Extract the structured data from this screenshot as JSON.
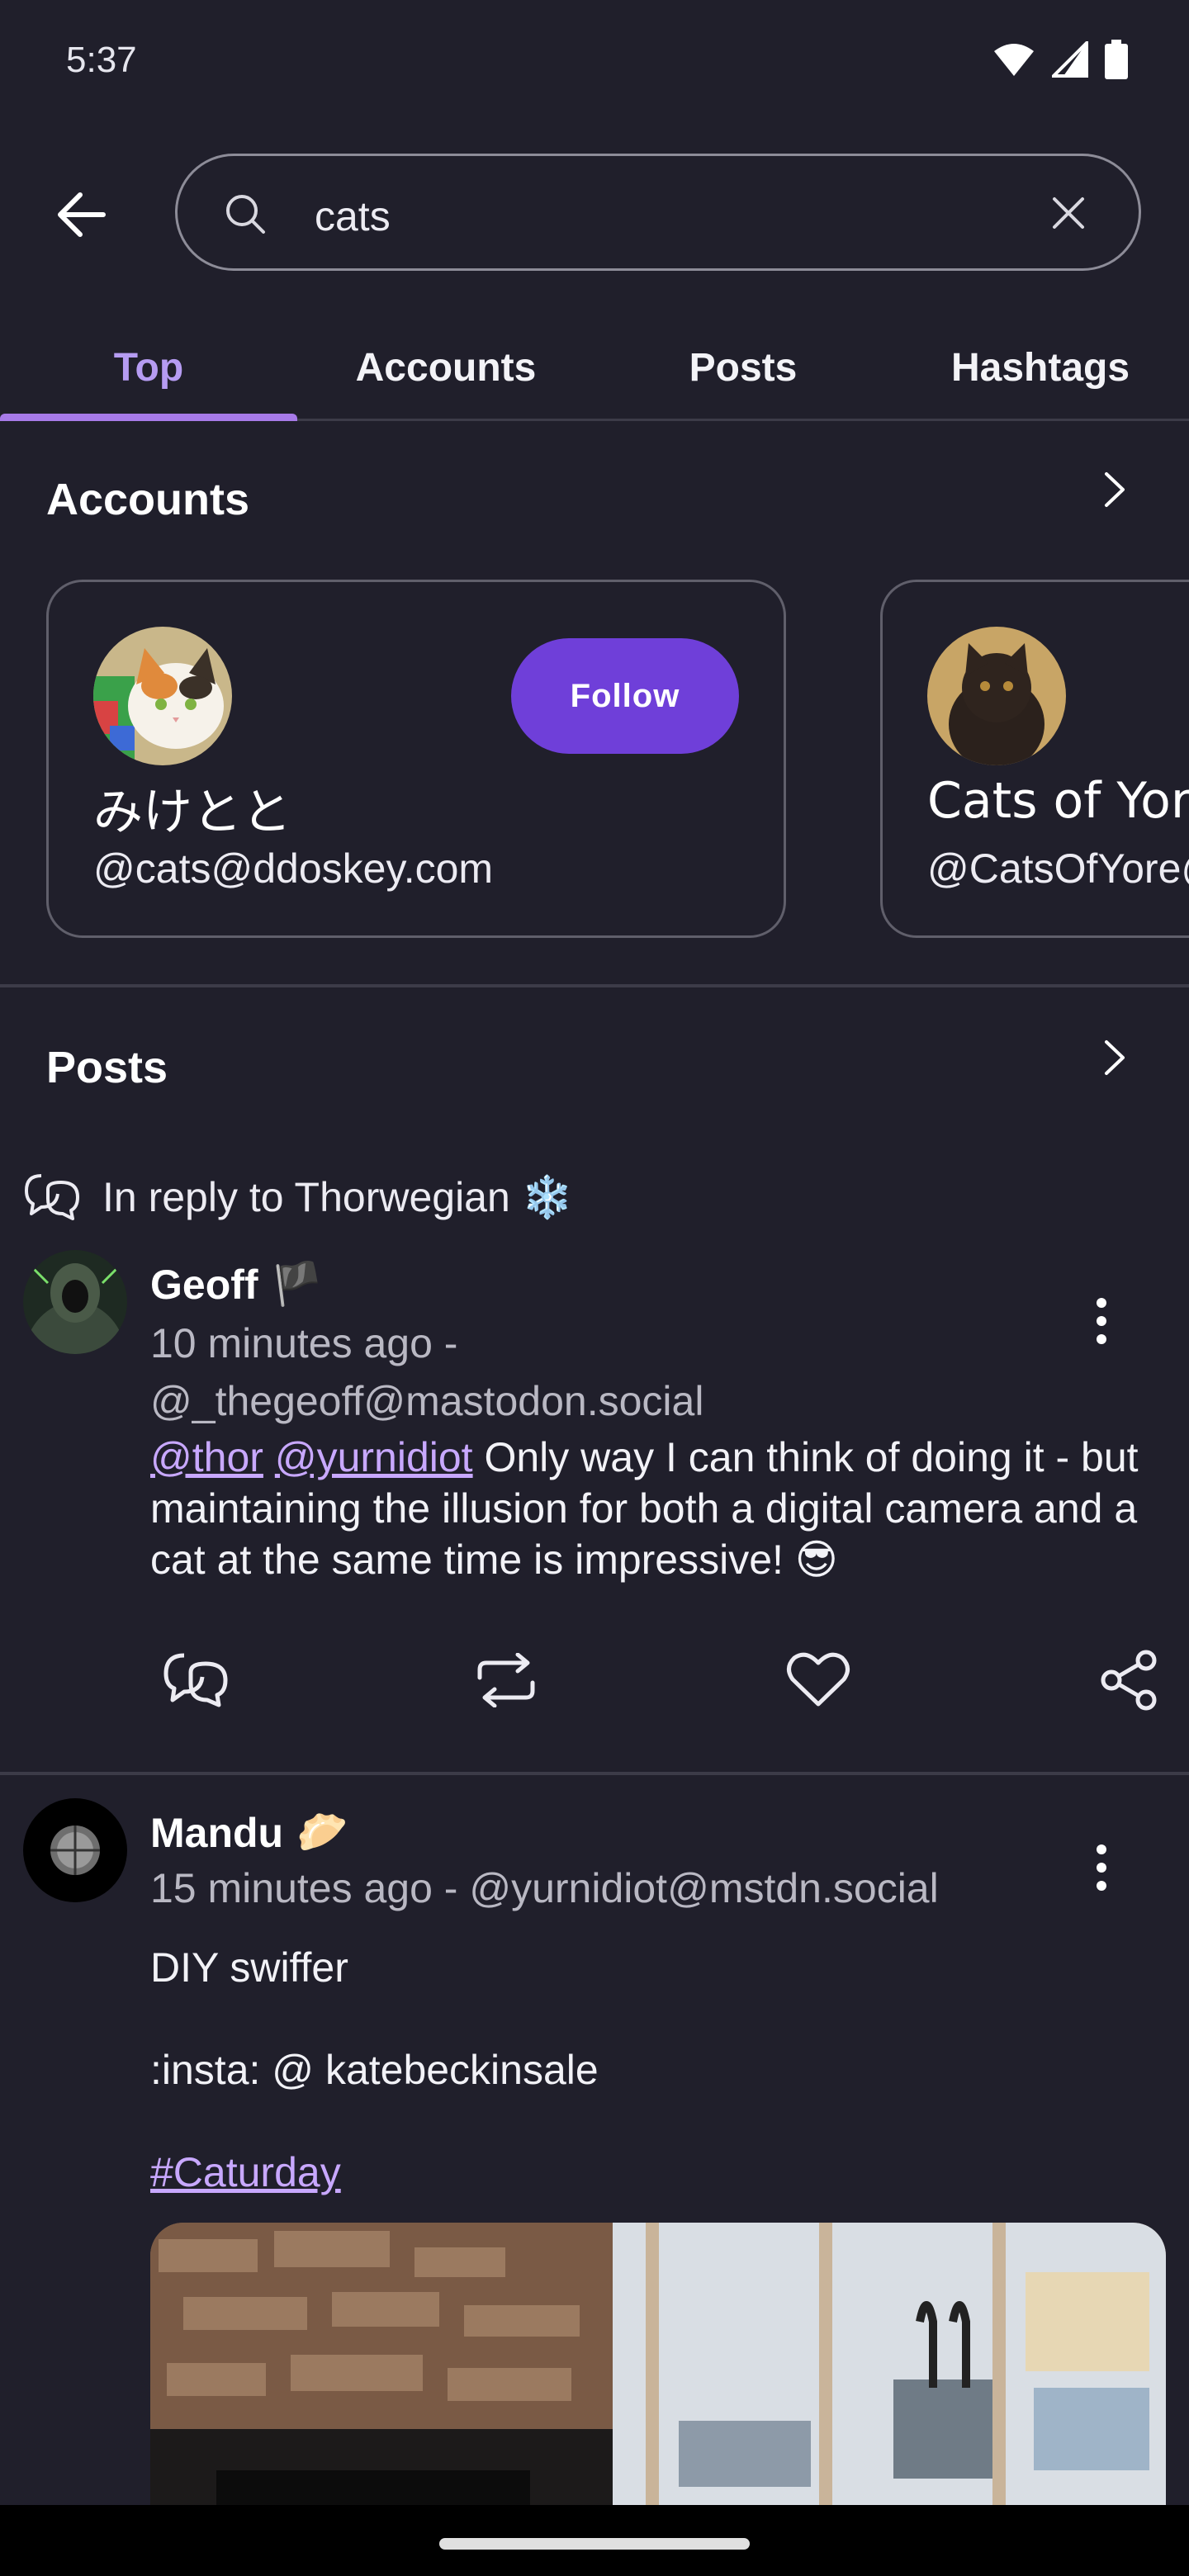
{
  "status": {
    "time": "5:37"
  },
  "search": {
    "query": "cats"
  },
  "tabs": [
    "Top",
    "Accounts",
    "Posts",
    "Hashtags"
  ],
  "sections": {
    "accounts": "Accounts",
    "posts": "Posts"
  },
  "accounts": [
    {
      "name": "みけとと",
      "handle": "@cats@ddoskey.com",
      "follow_label": "Follow"
    },
    {
      "name": "Cats of Yore",
      "handle": "@CatsOfYore@"
    }
  ],
  "posts": [
    {
      "reply_to": "In reply to Thorwegian ❄️",
      "author": "Geoff",
      "author_emoji": "🏴",
      "time": "10 minutes ago -",
      "handle": "@_thegeoff@mastodon.social",
      "mentions": [
        "@thor",
        "@yurnidiot"
      ],
      "text": " Only way I can think of doing it - but maintaining the illusion for both a digital camera and a cat at the same time is impressive! 😎"
    },
    {
      "author": "Mandu",
      "author_emoji": "🥟",
      "time_handle": "15 minutes ago - @yurnidiot@mstdn.social",
      "line1": "DIY swiffer",
      "line2": ":insta: @ katebeckinsale",
      "hashtag": "#Caturday"
    }
  ],
  "colors": {
    "accent": "#a77ae8",
    "follow": "#6f3fd9",
    "background": "#201f2b",
    "link": "#c8a8ff"
  }
}
